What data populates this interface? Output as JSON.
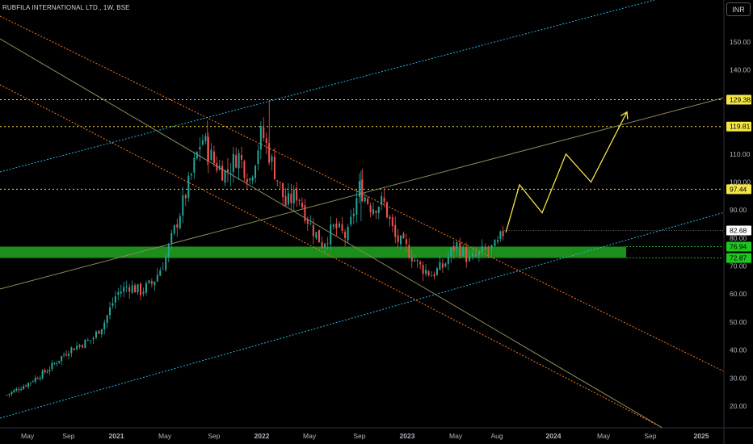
{
  "header": {
    "title": "RUBFILA INTERNATIONAL LTD., 1W, BSE",
    "currency": "INR"
  },
  "colors": {
    "background": "#000000",
    "up": "#26a69a",
    "down": "#ef5350",
    "zone": "#1e9d1e",
    "channel_blue": "#29b6e0",
    "channel_orange": "#ff7a1a",
    "midline": "#8a8a5a",
    "level": "#f5e642",
    "projection": "#f5e642"
  },
  "chart_data": {
    "type": "candlestick",
    "y_axis": {
      "ylim": [
        13,
        160
      ],
      "ticks": [
        "20.00",
        "30.00",
        "40.00",
        "50.00",
        "60.00",
        "70.00",
        "80.00",
        "90.00",
        "100.00",
        "110.00",
        "140.00",
        "150.00"
      ]
    },
    "x_axis": {
      "labels": [
        "May",
        "Sep",
        "2021",
        "May",
        "Sep",
        "2022",
        "May",
        "Sep",
        "2023",
        "May",
        "Aug",
        "2024",
        "May",
        "Sep",
        "2025"
      ]
    },
    "price_labels": [
      {
        "text": "129.38",
        "value": 129.38,
        "style": "level"
      },
      {
        "text": "119.81",
        "value": 119.81,
        "style": "level"
      },
      {
        "text": "97.44",
        "value": 97.44,
        "style": "level"
      },
      {
        "text": "82.68",
        "value": 82.68,
        "style": "last"
      },
      {
        "text": "76.94",
        "value": 76.94,
        "style": "zone"
      },
      {
        "text": "72.87",
        "value": 72.87,
        "style": "zone"
      }
    ],
    "horizontal_levels": [
      129.38,
      119.81,
      97.44
    ],
    "demand_zone": [
      72.87,
      76.94
    ],
    "price_path": [
      [
        "2020-03",
        24
      ],
      [
        "2020-05",
        28
      ],
      [
        "2020-07",
        33
      ],
      [
        "2020-09",
        40
      ],
      [
        "2020-11",
        44
      ],
      [
        "2020-12",
        50
      ],
      [
        "2021-01",
        60
      ],
      [
        "2021-02",
        63
      ],
      [
        "2021-03",
        61
      ],
      [
        "2021-04",
        64
      ],
      [
        "2021-05",
        72
      ],
      [
        "2021-06",
        86
      ],
      [
        "2021-07",
        100
      ],
      [
        "2021-08",
        116
      ],
      [
        "2021-09",
        107
      ],
      [
        "2021-10",
        103
      ],
      [
        "2021-11",
        110
      ],
      [
        "2021-12",
        101
      ],
      [
        "2022-01",
        118
      ],
      [
        "2022-02",
        105
      ],
      [
        "2022-03",
        92
      ],
      [
        "2022-04",
        96
      ],
      [
        "2022-05",
        85
      ],
      [
        "2022-06",
        78
      ],
      [
        "2022-07",
        84
      ],
      [
        "2022-08",
        80
      ],
      [
        "2022-09",
        98
      ],
      [
        "2022-10",
        91
      ],
      [
        "2022-11",
        93
      ],
      [
        "2022-12",
        80
      ],
      [
        "2023-01",
        76
      ],
      [
        "2023-02",
        70
      ],
      [
        "2023-03",
        67
      ],
      [
        "2023-04",
        70
      ],
      [
        "2023-05",
        78
      ],
      [
        "2023-06",
        72
      ],
      [
        "2023-07",
        75
      ],
      [
        "2023-08",
        77
      ],
      [
        "2023-08-20",
        82.68
      ]
    ],
    "projection_path": [
      [
        "2023-08-25",
        82
      ],
      [
        "2023-10",
        99
      ],
      [
        "2023-12",
        89
      ],
      [
        "2024-02",
        110
      ],
      [
        "2024-04",
        100
      ],
      [
        "2024-07",
        125
      ]
    ],
    "grid": false,
    "legend": false
  }
}
